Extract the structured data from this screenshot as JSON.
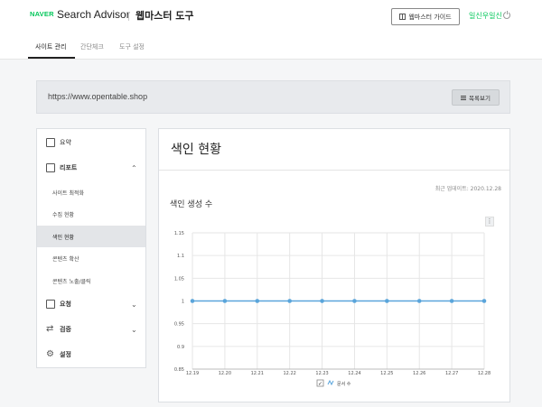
{
  "header": {
    "naver": "NAVER",
    "app_name": "Search Advisor",
    "tool_title": "웹마스터 도구",
    "guide_button": "웹마스터 가이드",
    "user": "일신우일신"
  },
  "tabs": [
    {
      "label": "사이트 관리",
      "active": true
    },
    {
      "label": "간단체크",
      "active": false
    },
    {
      "label": "도구 설정",
      "active": false
    }
  ],
  "site": {
    "url": "https://www.opentable.shop",
    "list_button": "목록보기"
  },
  "sidebar": {
    "summary": "요약",
    "report": "리포트",
    "report_items": [
      {
        "label": "사이트 최적화",
        "active": false
      },
      {
        "label": "수집 현황",
        "active": false
      },
      {
        "label": "색인 현황",
        "active": true
      },
      {
        "label": "콘텐츠 확산",
        "active": false
      },
      {
        "label": "콘텐츠 노출/클릭",
        "active": false
      }
    ],
    "request": "요청",
    "verify": "검증",
    "settings": "설정"
  },
  "main": {
    "title": "색인 현황",
    "updated": "최근 업데이트: 2020.12.28",
    "section_title": "색인 생성 수",
    "kebab": "⋮"
  },
  "colors": {
    "brand": "#03c75a",
    "series": "#5aa5db"
  },
  "chart_data": {
    "type": "line",
    "x": [
      "12.19",
      "12.20",
      "12.21",
      "12.22",
      "12.23",
      "12.24",
      "12.25",
      "12.26",
      "12.27",
      "12.28"
    ],
    "series": [
      {
        "name": "문서 수",
        "values": [
          1,
          1,
          1,
          1,
          1,
          1,
          1,
          1,
          1,
          1
        ]
      }
    ],
    "yticks": [
      "1.15",
      "1.1",
      "1.05",
      "1",
      "0.95",
      "0.9",
      "0.85"
    ],
    "ylim": [
      0.85,
      1.15
    ],
    "grid": true,
    "legend": "bottom"
  }
}
